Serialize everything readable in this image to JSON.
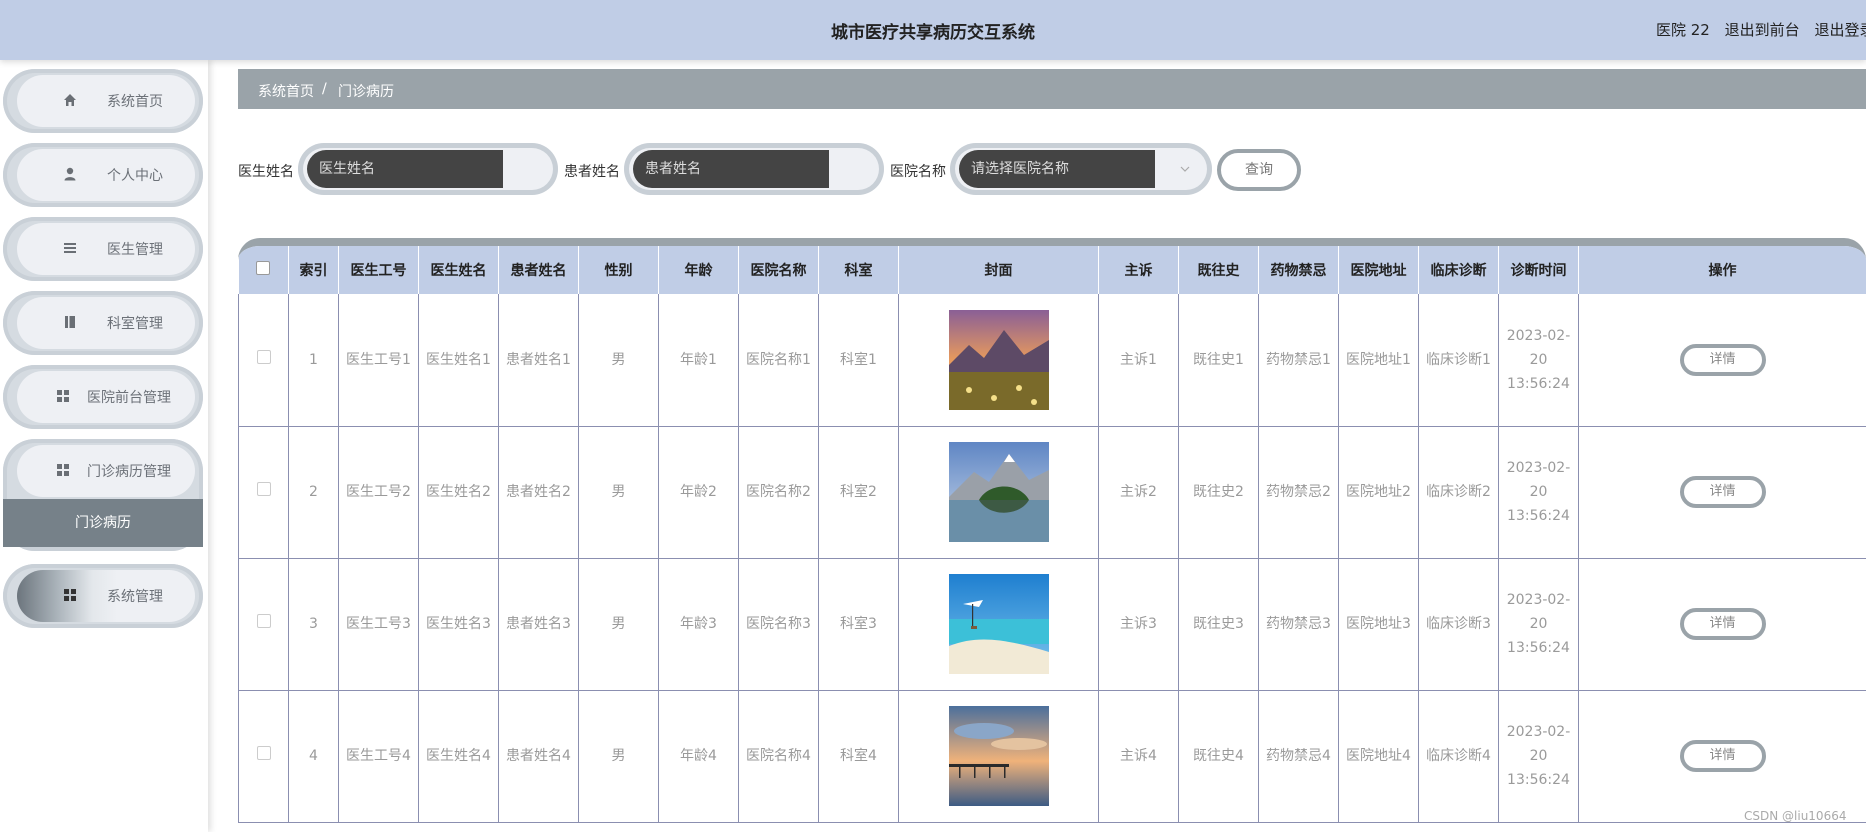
{
  "header": {
    "title": "城市医疗共享病历交互系统",
    "user": "医院 22",
    "back_front": "退出到前台",
    "logout": "退出登录"
  },
  "sidebar": {
    "items": [
      {
        "label": "系统首页",
        "icon": "home-icon"
      },
      {
        "label": "个人中心",
        "icon": "user-icon"
      },
      {
        "label": "医生管理",
        "icon": "list-icon"
      },
      {
        "label": "科室管理",
        "icon": "book-icon"
      },
      {
        "label": "医院前台管理",
        "icon": "grid-icon"
      },
      {
        "label": "门诊病历管理",
        "icon": "grid-icon"
      },
      {
        "label": "系统管理",
        "icon": "grid-icon"
      }
    ],
    "submenu_active": "门诊病历"
  },
  "breadcrumb": {
    "home": "系统首页",
    "sep": "/",
    "current": "门诊病历"
  },
  "search": {
    "doctor_label": "医生姓名",
    "doctor_placeholder": "医生姓名",
    "patient_label": "患者姓名",
    "patient_placeholder": "患者姓名",
    "hospital_label": "医院名称",
    "hospital_placeholder": "请选择医院名称",
    "query_button": "查询"
  },
  "table": {
    "headers": [
      "索引",
      "医生工号",
      "医生姓名",
      "患者姓名",
      "性别",
      "年龄",
      "医院名称",
      "科室",
      "封面",
      "主诉",
      "既往史",
      "药物禁忌",
      "医院地址",
      "临床诊断",
      "诊断时间",
      "操作"
    ],
    "detail_label": "详情",
    "rows": [
      {
        "index": "1",
        "doctor_no": "医生工号1",
        "doctor_name": "医生姓名1",
        "patient_name": "患者姓名1",
        "gender": "男",
        "age": "年龄1",
        "hospital": "医院名称1",
        "dept": "科室1",
        "cover": "mountain-meadow",
        "complaint": "主诉1",
        "history": "既往史1",
        "taboo": "药物禁忌1",
        "address": "医院地址1",
        "diagnosis": "临床诊断1",
        "time": "2023-02-20 13:56:24"
      },
      {
        "index": "2",
        "doctor_no": "医生工号2",
        "doctor_name": "医生姓名2",
        "patient_name": "患者姓名2",
        "gender": "男",
        "age": "年龄2",
        "hospital": "医院名称2",
        "dept": "科室2",
        "cover": "mountain-lake",
        "complaint": "主诉2",
        "history": "既往史2",
        "taboo": "药物禁忌2",
        "address": "医院地址2",
        "diagnosis": "临床诊断2",
        "time": "2023-02-20 13:56:24"
      },
      {
        "index": "3",
        "doctor_no": "医生工号3",
        "doctor_name": "医生姓名3",
        "patient_name": "患者姓名3",
        "gender": "男",
        "age": "年龄3",
        "hospital": "医院名称3",
        "dept": "科室3",
        "cover": "tropical-beach",
        "complaint": "主诉3",
        "history": "既往史3",
        "taboo": "药物禁忌3",
        "address": "医院地址3",
        "diagnosis": "临床诊断3",
        "time": "2023-02-20 13:56:24"
      },
      {
        "index": "4",
        "doctor_no": "医生工号4",
        "doctor_name": "医生姓名4",
        "patient_name": "患者姓名4",
        "gender": "男",
        "age": "年龄4",
        "hospital": "医院名称4",
        "dept": "科室4",
        "cover": "pier-sunset",
        "complaint": "主诉4",
        "history": "既往史4",
        "taboo": "药物禁忌4",
        "address": "医院地址4",
        "diagnosis": "临床诊断4",
        "time": "2023-02-20 13:56:24"
      }
    ]
  },
  "watermark": "CSDN @liu10664"
}
